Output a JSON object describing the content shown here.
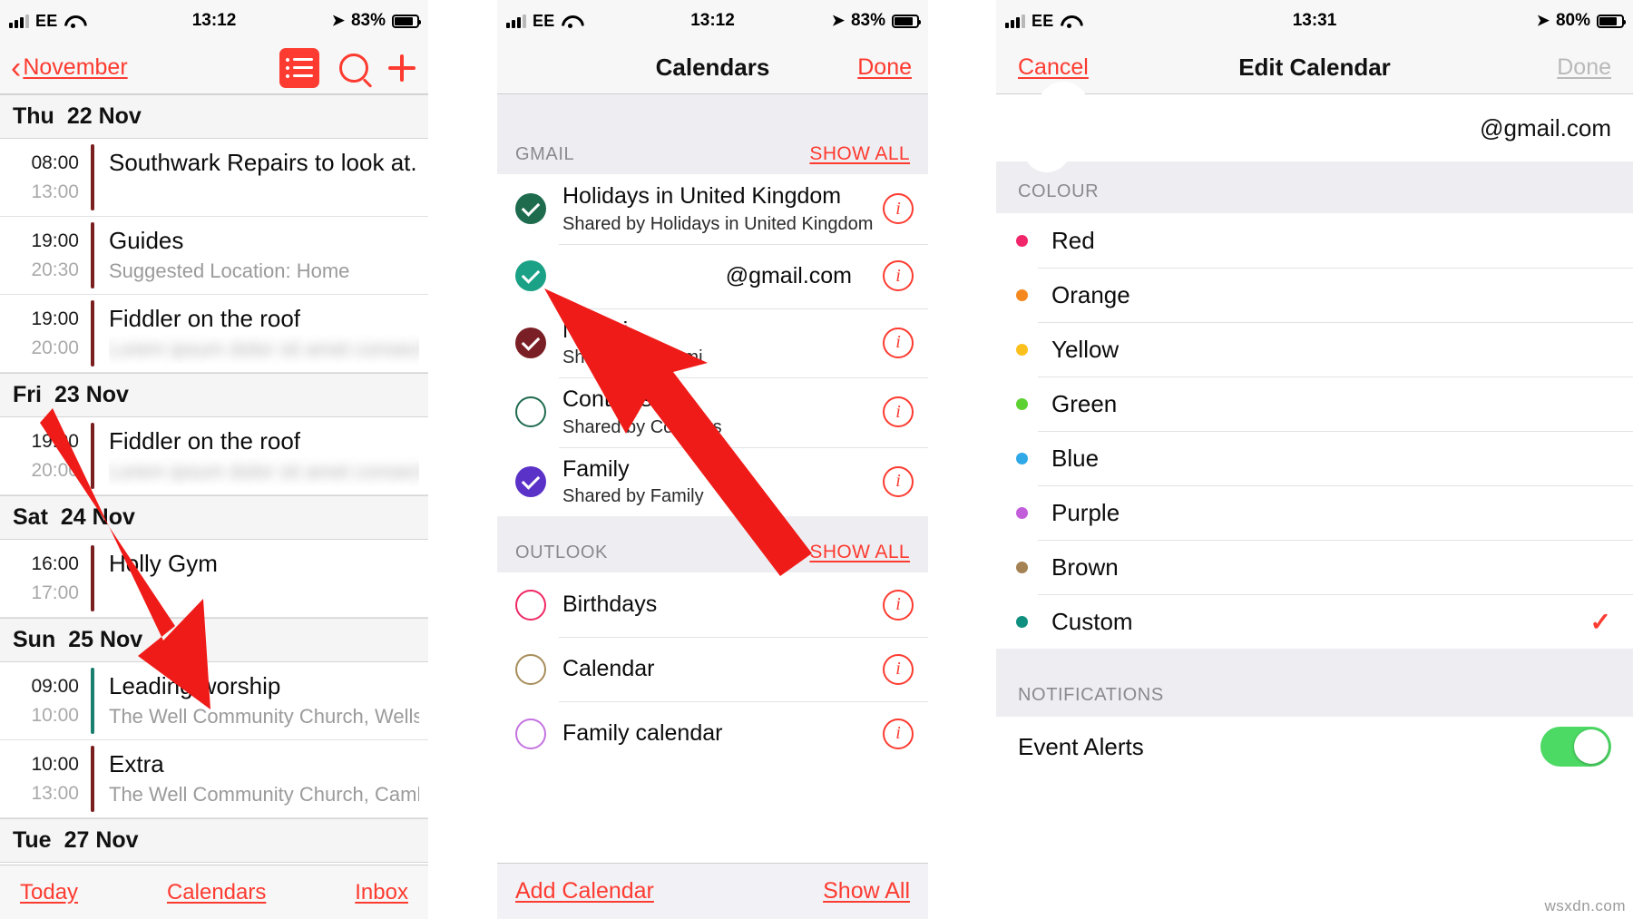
{
  "panel1": {
    "status": {
      "carrier": "EE",
      "time": "13:12",
      "battery": "83%"
    },
    "nav": {
      "back_label": "November"
    },
    "icons": {
      "list": "list-view-icon",
      "search": "search-icon",
      "add": "plus-icon"
    },
    "agenda": [
      {
        "day": "Thu",
        "date": "22 Nov",
        "events": [
          {
            "start": "08:00",
            "end": "13:00",
            "title": "Southwark Repairs to look at...",
            "sub": "",
            "blurred": false,
            "color": "#7a1f1f"
          },
          {
            "start": "19:00",
            "end": "20:30",
            "title": "Guides",
            "sub": "Suggested Location: Home",
            "blurred": false,
            "color": "#7a1f1f"
          },
          {
            "start": "19:00",
            "end": "20:00",
            "title": "Fiddler on the roof",
            "sub": "Lorem ipsum dolor sit amet consect",
            "blurred": true,
            "color": "#7a1f1f"
          }
        ]
      },
      {
        "day": "Fri",
        "date": "23 Nov",
        "events": [
          {
            "start": "19:00",
            "end": "20:00",
            "title": "Fiddler on the roof",
            "sub": "Lorem ipsum dolor sit amet consect",
            "blurred": true,
            "color": "#7a1f1f"
          }
        ]
      },
      {
        "day": "Sat",
        "date": "24 Nov",
        "events": [
          {
            "start": "16:00",
            "end": "17:00",
            "title": "Holly Gym",
            "sub": "",
            "blurred": false,
            "color": "#7a1f1f"
          }
        ]
      },
      {
        "day": "Sun",
        "date": "25 Nov",
        "events": [
          {
            "start": "09:00",
            "end": "10:00",
            "title": "Leading worship",
            "sub": "The Well Community Church, Wells Wa...",
            "blurred": false,
            "color": "#1a7f6e"
          },
          {
            "start": "10:00",
            "end": "13:00",
            "title": "Extra",
            "sub": "The Well Community Church, Camberw...",
            "blurred": false,
            "color": "#7a1f1f"
          }
        ]
      },
      {
        "day": "Tue",
        "date": "27 Nov",
        "events": []
      }
    ],
    "tabbar": {
      "today": "Today",
      "calendars": "Calendars",
      "inbox": "Inbox"
    }
  },
  "panel2": {
    "status": {
      "carrier": "EE",
      "time": "13:12",
      "battery": "83%"
    },
    "nav": {
      "title": "Calendars",
      "done": "Done"
    },
    "sections": [
      {
        "header": "GMAIL",
        "show_all": "SHOW ALL",
        "rows": [
          {
            "name": "Holidays in United Kingdom",
            "sub": "Shared by Holidays in United Kingdom",
            "checked": true,
            "color": "#1e6b4e",
            "align": "left"
          },
          {
            "name": "@gmail.com",
            "sub": "",
            "checked": true,
            "color": "#1aa186",
            "align": "right"
          },
          {
            "name": "Naomi",
            "sub": "Shared by Naomi",
            "checked": true,
            "color": "#7b1f26",
            "align": "left"
          },
          {
            "name": "Contacts",
            "sub": "Shared by Contacts",
            "checked": false,
            "color": "#1e6b4e",
            "align": "left"
          },
          {
            "name": "Family",
            "sub": "Shared by Family",
            "checked": true,
            "color": "#5b32c8",
            "align": "left"
          }
        ]
      },
      {
        "header": "OUTLOOK",
        "show_all": "SHOW ALL",
        "rows": [
          {
            "name": "Birthdays",
            "sub": "",
            "checked": false,
            "color": "#ef2864",
            "align": "left"
          },
          {
            "name": "Calendar",
            "sub": "",
            "checked": false,
            "color": "#a78d5a",
            "align": "left"
          },
          {
            "name": "Family calendar",
            "sub": "",
            "checked": false,
            "color": "#c473e0",
            "align": "left"
          }
        ]
      }
    ],
    "footer": {
      "add_calendar": "Add Calendar",
      "show_all": "Show All"
    }
  },
  "panel3": {
    "status": {
      "carrier": "EE",
      "time": "13:31",
      "battery": "80%"
    },
    "nav": {
      "cancel": "Cancel",
      "title": "Edit Calendar",
      "done": "Done",
      "done_disabled": true
    },
    "account_name": "@gmail.com",
    "colour_section_header": "COLOUR",
    "colours": [
      {
        "label": "Red",
        "hex": "#f0256a",
        "selected": false
      },
      {
        "label": "Orange",
        "hex": "#f5881f",
        "selected": false
      },
      {
        "label": "Yellow",
        "hex": "#fcc01c",
        "selected": false
      },
      {
        "label": "Green",
        "hex": "#5ed132",
        "selected": false
      },
      {
        "label": "Blue",
        "hex": "#2fa8e8",
        "selected": false
      },
      {
        "label": "Purple",
        "hex": "#c35edb",
        "selected": false
      },
      {
        "label": "Brown",
        "hex": "#a58254",
        "selected": false
      },
      {
        "label": "Custom",
        "hex": "#0e8f7f",
        "selected": true
      }
    ],
    "selected_tick": "✓",
    "notifications_header": "NOTIFICATIONS",
    "event_alerts": {
      "label": "Event Alerts",
      "on": true
    }
  },
  "annotations": {
    "arrow1_target": "gmail-calendar-checkbox",
    "arrow2_target": "calendars-tab-button"
  },
  "watermark": "wsxdn.com"
}
